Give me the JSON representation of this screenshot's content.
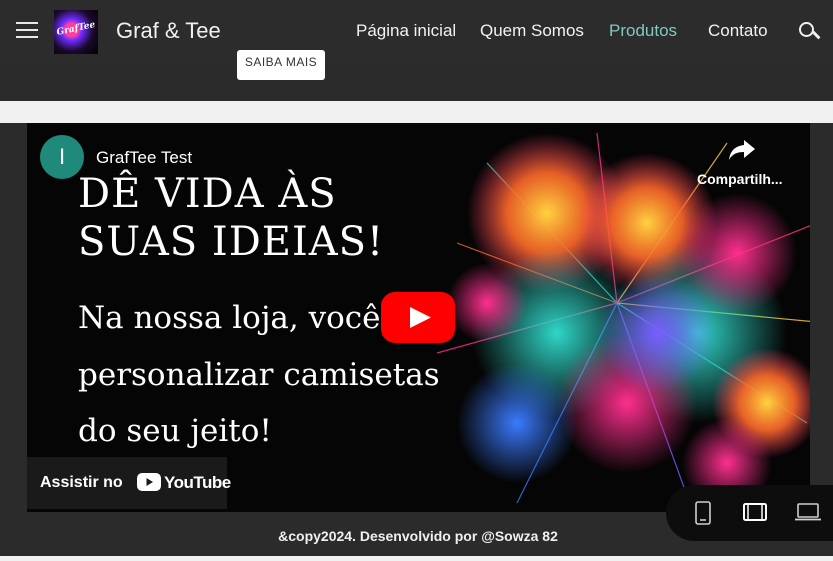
{
  "header": {
    "site_title": "Graf & Tee",
    "logo_text": "GrafTee",
    "nav": [
      {
        "label": "Página inicial"
      },
      {
        "label": "Quem Somos"
      },
      {
        "label": "Produtos",
        "active": true
      },
      {
        "label": "Contato"
      }
    ]
  },
  "hero": {
    "button_label": "SAIBA MAIS"
  },
  "video": {
    "channel_initial": "I",
    "channel_name": "GrafTee Test",
    "share_label": "Compartilh...",
    "headline": [
      "DÊ VIDA ÀS",
      "SUAS IDEIAS!"
    ],
    "subline": [
      "Na nossa loja, você po",
      "personalizar camisetas",
      "do seu jeito!"
    ],
    "watch_label": "Assistir no",
    "youtube_word": "YouTube"
  },
  "footer": {
    "text": "&copy2024. Desenvolvido por @Sowza 82"
  },
  "device_bar": [
    "phone-icon",
    "tablet-icon",
    "laptop-icon"
  ],
  "colors": {
    "header_bg": "#2c2c2c",
    "nav_active": "#7fc9c0",
    "channel_avatar": "#1f8a7c",
    "play_red": "#ff0000"
  }
}
